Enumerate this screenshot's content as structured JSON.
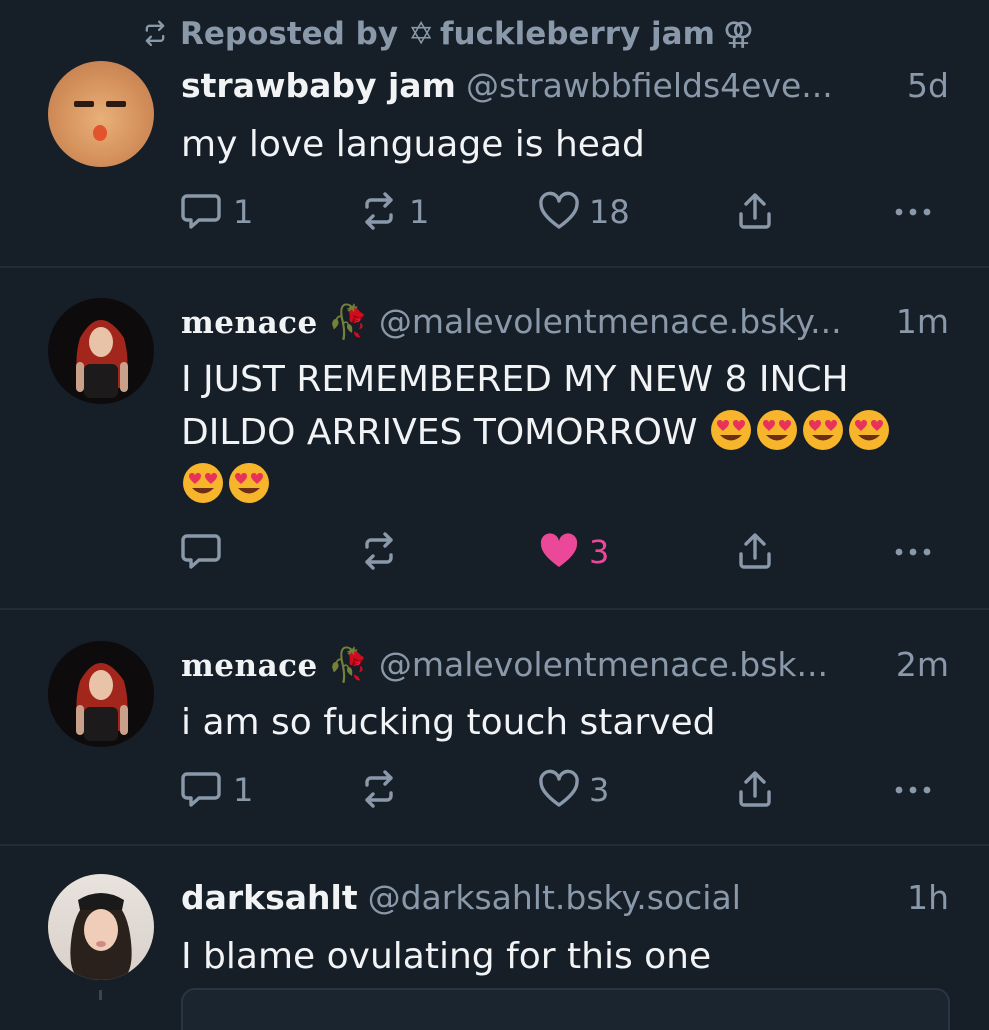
{
  "repost": {
    "prefix": "Reposted by",
    "reposter_name": "fuckleberry jam"
  },
  "posts": [
    {
      "name": "strawbaby jam",
      "handle": "@strawbbfields4eve...",
      "time": "5d",
      "text": "my love language is head",
      "replies": "1",
      "reposts": "1",
      "likes": "18",
      "liked": false
    },
    {
      "name": "menace",
      "handle": "@malevolentmenace.bsky...",
      "time": "1m",
      "text_line1": "I JUST REMEMBERED MY NEW 8 INCH",
      "text_line2": "DILDO ARRIVES TOMORROW",
      "emoji_name": "heart-eyes-emoji",
      "replies": "",
      "reposts": "",
      "likes": "3",
      "liked": true
    },
    {
      "name": "menace",
      "handle": "@malevolentmenace.bsk...",
      "time": "2m",
      "text": "i am so fucking touch starved",
      "replies": "1",
      "reposts": "",
      "likes": "3",
      "liked": false
    },
    {
      "name": "darksahlt",
      "handle": "@darksahlt.bsky.social",
      "time": "1h",
      "text": "I blame ovulating for this one"
    }
  ],
  "colors": {
    "background": "#161e27",
    "muted": "#8a99aa",
    "text": "#f1f3f5",
    "like": "#ec4899"
  }
}
